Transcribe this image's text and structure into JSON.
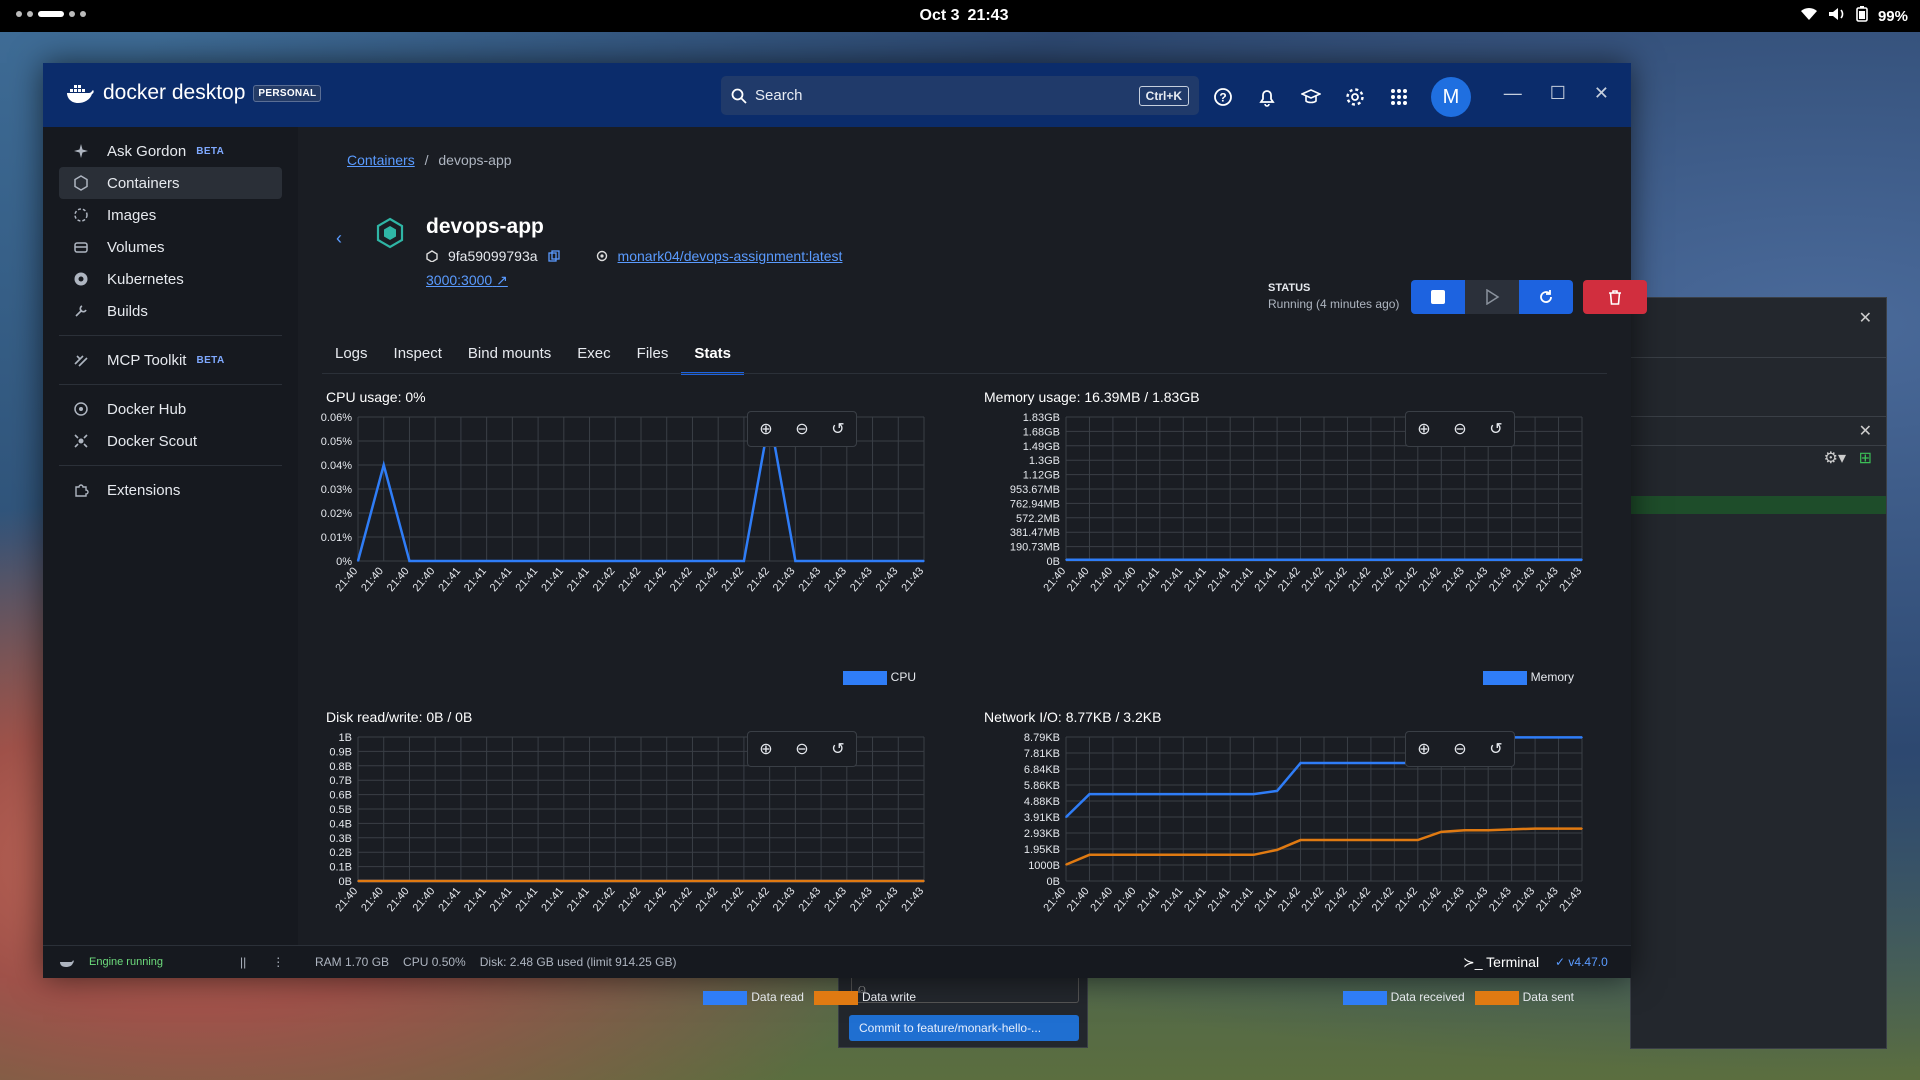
{
  "os": {
    "clock_date": "Oct 3",
    "clock_time": "21:43",
    "battery": "99%"
  },
  "app": {
    "brand": "docker desktop",
    "plan_badge": "PERSONAL",
    "search_placeholder": "Search",
    "search_shortcut": "Ctrl+K",
    "avatar_initial": "M"
  },
  "sidebar": {
    "items": [
      {
        "label": "Ask Gordon",
        "badge": "BETA",
        "icon": "sparkle-icon"
      },
      {
        "label": "Containers",
        "badge": "",
        "icon": "container-icon"
      },
      {
        "label": "Images",
        "badge": "",
        "icon": "image-icon"
      },
      {
        "label": "Volumes",
        "badge": "",
        "icon": "volume-icon"
      },
      {
        "label": "Kubernetes",
        "badge": "",
        "icon": "kubernetes-icon"
      },
      {
        "label": "Builds",
        "badge": "",
        "icon": "wrench-icon"
      },
      {
        "label": "MCP Toolkit",
        "badge": "BETA",
        "icon": "mcp-icon"
      },
      {
        "label": "Docker Hub",
        "badge": "",
        "icon": "hub-icon"
      },
      {
        "label": "Docker Scout",
        "badge": "",
        "icon": "scout-icon"
      },
      {
        "label": "Extensions",
        "badge": "",
        "icon": "puzzle-icon"
      }
    ]
  },
  "breadcrumb": {
    "parent": "Containers",
    "separator": "/",
    "current": "devops-app"
  },
  "container": {
    "name": "devops-app",
    "id": "9fa59099793a",
    "image": "monark04/devops-assignment:latest",
    "port": "3000:3000",
    "status_label": "STATUS",
    "status_value": "Running (4 minutes ago)"
  },
  "tabs": [
    "Logs",
    "Inspect",
    "Bind mounts",
    "Exec",
    "Files",
    "Stats"
  ],
  "active_tab": "Stats",
  "cards": {
    "cpu": {
      "title": "CPU usage:",
      "value": "0%"
    },
    "memory": {
      "title": "Memory usage:",
      "value": "16.39MB / 1.83GB"
    },
    "disk": {
      "title": "Disk read/write:",
      "value": "0B / 0B"
    },
    "network": {
      "title": "Network I/O:",
      "value": "8.77KB / 3.2KB"
    }
  },
  "chart_data": [
    {
      "type": "line",
      "title": "CPU usage",
      "x": [
        "21:40",
        "21:40",
        "21:40",
        "21:40",
        "21:41",
        "21:41",
        "21:41",
        "21:41",
        "21:41",
        "21:41",
        "21:42",
        "21:42",
        "21:42",
        "21:42",
        "21:42",
        "21:42",
        "21:42",
        "21:43",
        "21:43",
        "21:43",
        "21:43",
        "21:43",
        "21:43"
      ],
      "y_ticks": [
        "0%",
        "0.01%",
        "0.02%",
        "0.03%",
        "0.04%",
        "0.05%",
        "0.06%"
      ],
      "ylim": [
        0,
        0.06
      ],
      "series": [
        {
          "name": "CPU",
          "color": "#2f7df7",
          "values": [
            0,
            0.04,
            0,
            0,
            0,
            0,
            0,
            0,
            0,
            0,
            0,
            0,
            0,
            0,
            0,
            0,
            0.06,
            0,
            0,
            0,
            0,
            0,
            0
          ]
        }
      ]
    },
    {
      "type": "line",
      "title": "Memory usage",
      "x": [
        "21:40",
        "21:40",
        "21:40",
        "21:40",
        "21:41",
        "21:41",
        "21:41",
        "21:41",
        "21:41",
        "21:41",
        "21:42",
        "21:42",
        "21:42",
        "21:42",
        "21:42",
        "21:42",
        "21:42",
        "21:43",
        "21:43",
        "21:43",
        "21:43",
        "21:43",
        "21:43"
      ],
      "y_ticks": [
        "0B",
        "190.73MB",
        "381.47MB",
        "572.2MB",
        "762.94MB",
        "953.67MB",
        "1.12GB",
        "1.3GB",
        "1.49GB",
        "1.68GB",
        "1.83GB"
      ],
      "ylim": [
        0,
        1.83
      ],
      "series": [
        {
          "name": "Memory",
          "color": "#2f7df7",
          "values": [
            0.016,
            0.016,
            0.016,
            0.016,
            0.016,
            0.016,
            0.016,
            0.016,
            0.016,
            0.016,
            0.016,
            0.016,
            0.016,
            0.016,
            0.016,
            0.016,
            0.016,
            0.016,
            0.016,
            0.016,
            0.016,
            0.016,
            0.016
          ]
        }
      ]
    },
    {
      "type": "line",
      "title": "Disk read/write",
      "x": [
        "21:40",
        "21:40",
        "21:40",
        "21:40",
        "21:41",
        "21:41",
        "21:41",
        "21:41",
        "21:41",
        "21:41",
        "21:42",
        "21:42",
        "21:42",
        "21:42",
        "21:42",
        "21:42",
        "21:42",
        "21:43",
        "21:43",
        "21:43",
        "21:43",
        "21:43",
        "21:43"
      ],
      "y_ticks": [
        "0B",
        "0.1B",
        "0.2B",
        "0.3B",
        "0.4B",
        "0.5B",
        "0.6B",
        "0.7B",
        "0.8B",
        "0.9B",
        "1B"
      ],
      "ylim": [
        0,
        1
      ],
      "series": [
        {
          "name": "Data read",
          "color": "#2f7df7",
          "values": [
            0,
            0,
            0,
            0,
            0,
            0,
            0,
            0,
            0,
            0,
            0,
            0,
            0,
            0,
            0,
            0,
            0,
            0,
            0,
            0,
            0,
            0,
            0
          ]
        },
        {
          "name": "Data write",
          "color": "#e07a12",
          "values": [
            0,
            0,
            0,
            0,
            0,
            0,
            0,
            0,
            0,
            0,
            0,
            0,
            0,
            0,
            0,
            0,
            0,
            0,
            0,
            0,
            0,
            0,
            0
          ]
        }
      ]
    },
    {
      "type": "line",
      "title": "Network I/O",
      "x": [
        "21:40",
        "21:40",
        "21:40",
        "21:40",
        "21:41",
        "21:41",
        "21:41",
        "21:41",
        "21:41",
        "21:41",
        "21:42",
        "21:42",
        "21:42",
        "21:42",
        "21:42",
        "21:42",
        "21:42",
        "21:43",
        "21:43",
        "21:43",
        "21:43",
        "21:43",
        "21:43"
      ],
      "y_ticks": [
        "0B",
        "1000B",
        "1.95KB",
        "2.93KB",
        "3.91KB",
        "4.88KB",
        "5.86KB",
        "6.84KB",
        "7.81KB",
        "8.79KB"
      ],
      "ylim": [
        0,
        8.79
      ],
      "series": [
        {
          "name": "Data received",
          "color": "#2f7df7",
          "values": [
            3.9,
            5.3,
            5.3,
            5.3,
            5.3,
            5.3,
            5.3,
            5.3,
            5.3,
            5.5,
            7.2,
            7.2,
            7.2,
            7.2,
            7.2,
            7.2,
            8.77,
            8.77,
            8.77,
            8.77,
            8.77,
            8.77,
            8.77
          ]
        },
        {
          "name": "Data sent",
          "color": "#e07a12",
          "values": [
            1.0,
            1.6,
            1.6,
            1.6,
            1.6,
            1.6,
            1.6,
            1.6,
            1.6,
            1.9,
            2.5,
            2.5,
            2.5,
            2.5,
            2.5,
            2.5,
            3.0,
            3.1,
            3.1,
            3.15,
            3.2,
            3.2,
            3.2
          ]
        }
      ]
    }
  ],
  "footer": {
    "engine": "Engine running",
    "ram": "RAM 1.70 GB",
    "cpu": "CPU 0.50%",
    "disk": "Disk: 2.48 GB used (limit 914.25 GB)",
    "terminal": "Terminal",
    "version": "v4.47.0"
  },
  "background": {
    "commit_button": "Commit to feature/monark-hello-..."
  }
}
